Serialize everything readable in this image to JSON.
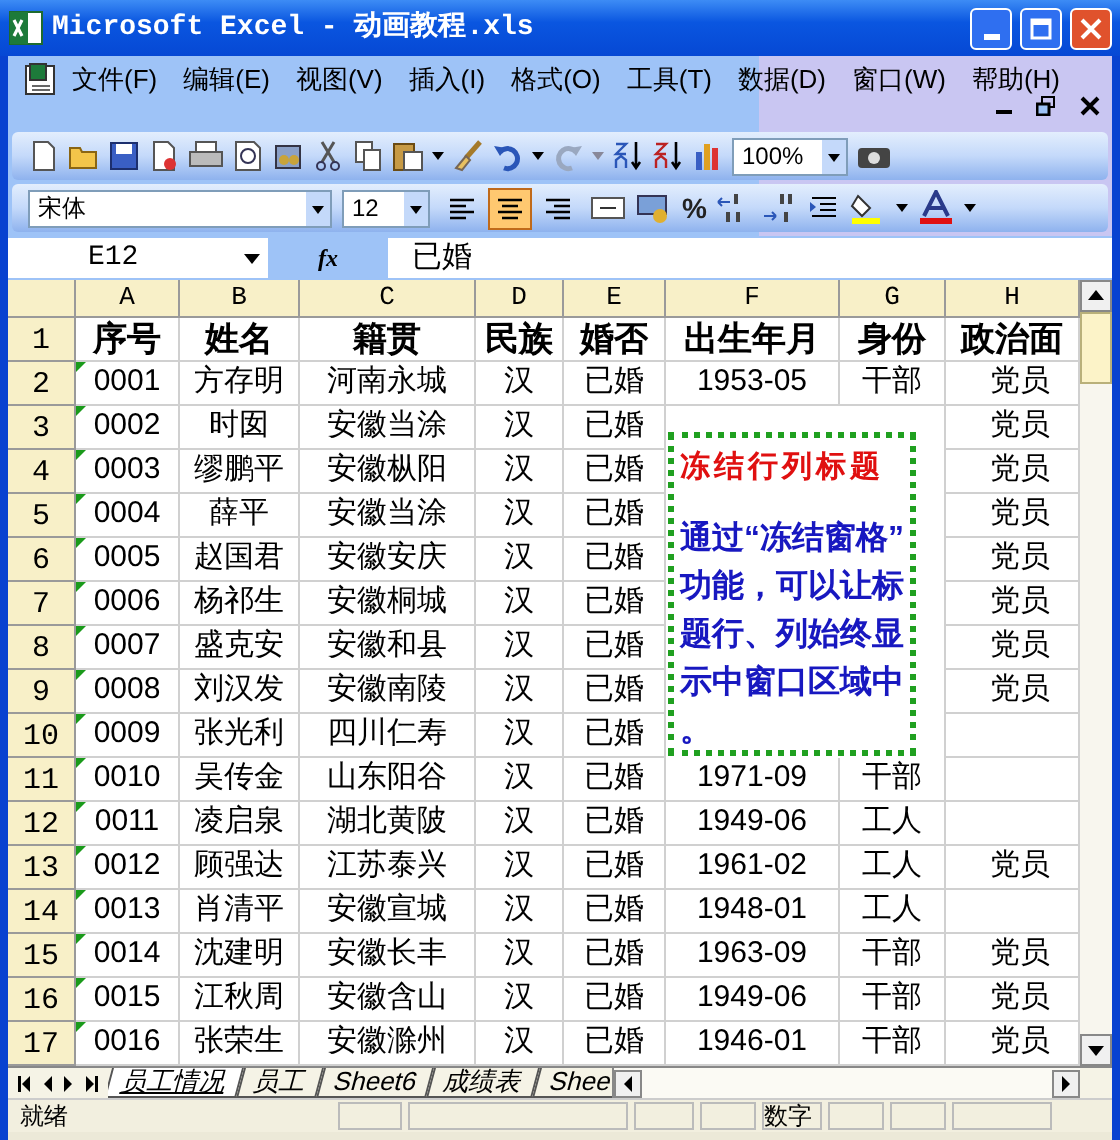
{
  "window": {
    "title": "Microsoft Excel - 动画教程.xls"
  },
  "menu": [
    "文件(F)",
    "编辑(E)",
    "视图(V)",
    "插入(I)",
    "格式(O)",
    "工具(T)",
    "数据(D)",
    "窗口(W)",
    "帮助(H)"
  ],
  "standard_toolbar": {
    "zoom": "100%"
  },
  "formatting_toolbar": {
    "font": "宋体",
    "size": "12",
    "percent_label": "%",
    "alignment": [
      {
        "kind": "left",
        "selected": false
      },
      {
        "kind": "center",
        "selected": true
      },
      {
        "kind": "right",
        "selected": false
      }
    ]
  },
  "formula_bar": {
    "name_box": "E12",
    "function_label": "fx",
    "value": "已婚"
  },
  "columns": [
    "A",
    "B",
    "C",
    "D",
    "E",
    "F",
    "G",
    "H"
  ],
  "header_row": {
    "number": "1",
    "cells": [
      "序号",
      "姓名",
      "籍贯",
      "民族",
      "婚否",
      "出生年月",
      "身份",
      "政治面"
    ]
  },
  "rows": [
    {
      "number": "2",
      "flagged": true,
      "cells": [
        "0001",
        "方存明",
        "河南永城",
        "汉",
        "已婚",
        "1953-05",
        "干部",
        "党员"
      ]
    },
    {
      "number": "3",
      "flagged": true,
      "cells": [
        "0002",
        "时囡",
        "安徽当涂",
        "汉",
        "已婚",
        null,
        null,
        "党员"
      ]
    },
    {
      "number": "4",
      "flagged": true,
      "cells": [
        "0003",
        "缪鹏平",
        "安徽枞阳",
        "汉",
        "已婚",
        null,
        null,
        "党员"
      ]
    },
    {
      "number": "5",
      "flagged": true,
      "cells": [
        "0004",
        "薛平",
        "安徽当涂",
        "汉",
        "已婚",
        null,
        null,
        "党员"
      ]
    },
    {
      "number": "6",
      "flagged": true,
      "cells": [
        "0005",
        "赵国君",
        "安徽安庆",
        "汉",
        "已婚",
        null,
        null,
        "党员"
      ]
    },
    {
      "number": "7",
      "flagged": true,
      "cells": [
        "0006",
        "杨祁生",
        "安徽桐城",
        "汉",
        "已婚",
        null,
        null,
        "党员"
      ]
    },
    {
      "number": "8",
      "flagged": true,
      "cells": [
        "0007",
        "盛克安",
        "安徽和县",
        "汉",
        "已婚",
        null,
        null,
        "党员"
      ]
    },
    {
      "number": "9",
      "flagged": true,
      "cells": [
        "0008",
        "刘汉发",
        "安徽南陵",
        "汉",
        "已婚",
        null,
        null,
        "党员"
      ]
    },
    {
      "number": "10",
      "flagged": true,
      "cells": [
        "0009",
        "张光利",
        "四川仁寿",
        "汉",
        "已婚",
        null,
        null,
        null
      ]
    },
    {
      "number": "11",
      "flagged": true,
      "cells": [
        "0010",
        "吴传金",
        "山东阳谷",
        "汉",
        "已婚",
        "1971-09",
        "干部",
        null
      ]
    },
    {
      "number": "12",
      "flagged": true,
      "cells": [
        "0011",
        "凌启泉",
        "湖北黄陂",
        "汉",
        "已婚",
        "1949-06",
        "工人",
        null
      ]
    },
    {
      "number": "13",
      "flagged": true,
      "cells": [
        "0012",
        "顾强达",
        "江苏泰兴",
        "汉",
        "已婚",
        "1961-02",
        "工人",
        "党员"
      ]
    },
    {
      "number": "14",
      "flagged": true,
      "cells": [
        "0013",
        "肖清平",
        "安徽宣城",
        "汉",
        "已婚",
        "1948-01",
        "工人",
        null
      ]
    },
    {
      "number": "15",
      "flagged": true,
      "cells": [
        "0014",
        "沈建明",
        "安徽长丰",
        "汉",
        "已婚",
        "1963-09",
        "干部",
        "党员"
      ]
    },
    {
      "number": "16",
      "flagged": true,
      "cells": [
        "0015",
        "江秋周",
        "安徽含山",
        "汉",
        "已婚",
        "1949-06",
        "干部",
        "党员"
      ]
    },
    {
      "number": "17",
      "flagged": true,
      "cells": [
        "0016",
        "张荣生",
        "安徽滁州",
        "汉",
        "已婚",
        "1946-01",
        "干部",
        "党员"
      ]
    }
  ],
  "callout": {
    "title": "冻结行列标题",
    "body": "通过“冻结窗格”功能，可以让标题行、列始终显示中窗口区域中。"
  },
  "sheet_tabs": [
    {
      "label": "员工情况",
      "selected": true
    },
    {
      "label": "员工",
      "selected": false
    },
    {
      "label": "Sheet6",
      "selected": false
    },
    {
      "label": "成绩表",
      "selected": false
    },
    {
      "label": "Shee",
      "selected": false
    }
  ],
  "status_bar": {
    "message": "就绪",
    "mode": "数字"
  }
}
